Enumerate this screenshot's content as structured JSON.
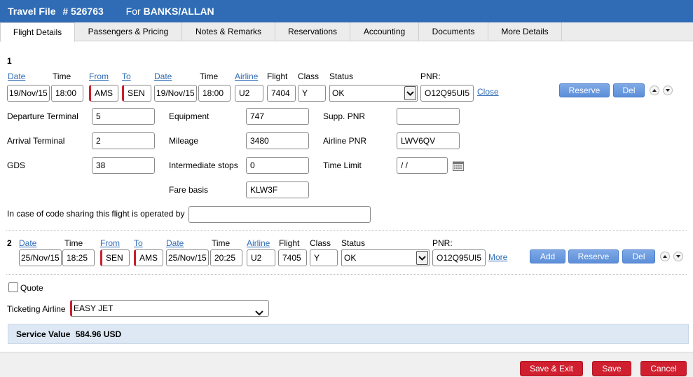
{
  "header": {
    "title": "Travel File",
    "file_number": "# 526763",
    "for_label": "For",
    "client": "BANKS/ALLAN"
  },
  "tabs": [
    {
      "label": "Flight Details",
      "active": true
    },
    {
      "label": "Passengers & Pricing"
    },
    {
      "label": "Notes & Remarks"
    },
    {
      "label": "Reservations"
    },
    {
      "label": "Accounting"
    },
    {
      "label": "Documents"
    },
    {
      "label": "More Details"
    }
  ],
  "labels": {
    "date": "Date",
    "time": "Time",
    "from": "From",
    "to": "To",
    "airline": "Airline",
    "flight": "Flight",
    "class": "Class",
    "status": "Status",
    "pnr": "PNR:"
  },
  "segment1": {
    "number": "1",
    "dep_date": "19/Nov/15",
    "dep_time": "18:00",
    "from": "AMS",
    "to": "SEN",
    "arr_date": "19/Nov/15",
    "arr_time": "18:00",
    "airline": "U2",
    "flight": "7404",
    "class": "Y",
    "status": "OK",
    "pnr": "O12Q95UI5",
    "close_link": "Close",
    "reserve_button": "Reserve",
    "del_button": "Del"
  },
  "details": {
    "departure_terminal_label": "Departure Terminal",
    "departure_terminal": "5",
    "arrival_terminal_label": "Arrival Terminal",
    "arrival_terminal": "2",
    "gds_label": "GDS",
    "gds": "38",
    "equipment_label": "Equipment",
    "equipment": "747",
    "mileage_label": "Mileage",
    "mileage": "3480",
    "stops_label": "Intermediate stops",
    "stops": "0",
    "fare_basis_label": "Fare basis",
    "fare_basis": "KLW3F",
    "supp_pnr_label": "Supp. PNR",
    "supp_pnr": "",
    "airline_pnr_label": "Airline PNR",
    "airline_pnr": "LWV6QV",
    "time_limit_label": "Time Limit",
    "time_limit": "/ /",
    "code_share_label": "In case of code sharing this flight is operated by",
    "code_share": ""
  },
  "segment2": {
    "number": "2",
    "dep_date": "25/Nov/15",
    "dep_time": "18:25",
    "from": "SEN",
    "to": "AMS",
    "arr_date": "25/Nov/15",
    "arr_time": "20:25",
    "airline": "U2",
    "flight": "7405",
    "class": "Y",
    "status": "OK",
    "pnr": "O12Q95UI5",
    "more_link": "More",
    "add_button": "Add",
    "reserve_button": "Reserve",
    "del_button": "Del"
  },
  "quote_label": "Quote",
  "ticketing": {
    "label": "Ticketing Airline",
    "value": "EASY JET"
  },
  "service": {
    "label": "Service Value",
    "value": "584.96 USD"
  },
  "footer": {
    "save_exit": "Save & Exit",
    "save": "Save",
    "cancel": "Cancel"
  },
  "colors": {
    "header_blue": "#2f6cb5",
    "link_blue": "#2f6cb5",
    "button_blue": "#6a98de",
    "button_red": "#d01f2e",
    "required_red": "#c8202e"
  }
}
